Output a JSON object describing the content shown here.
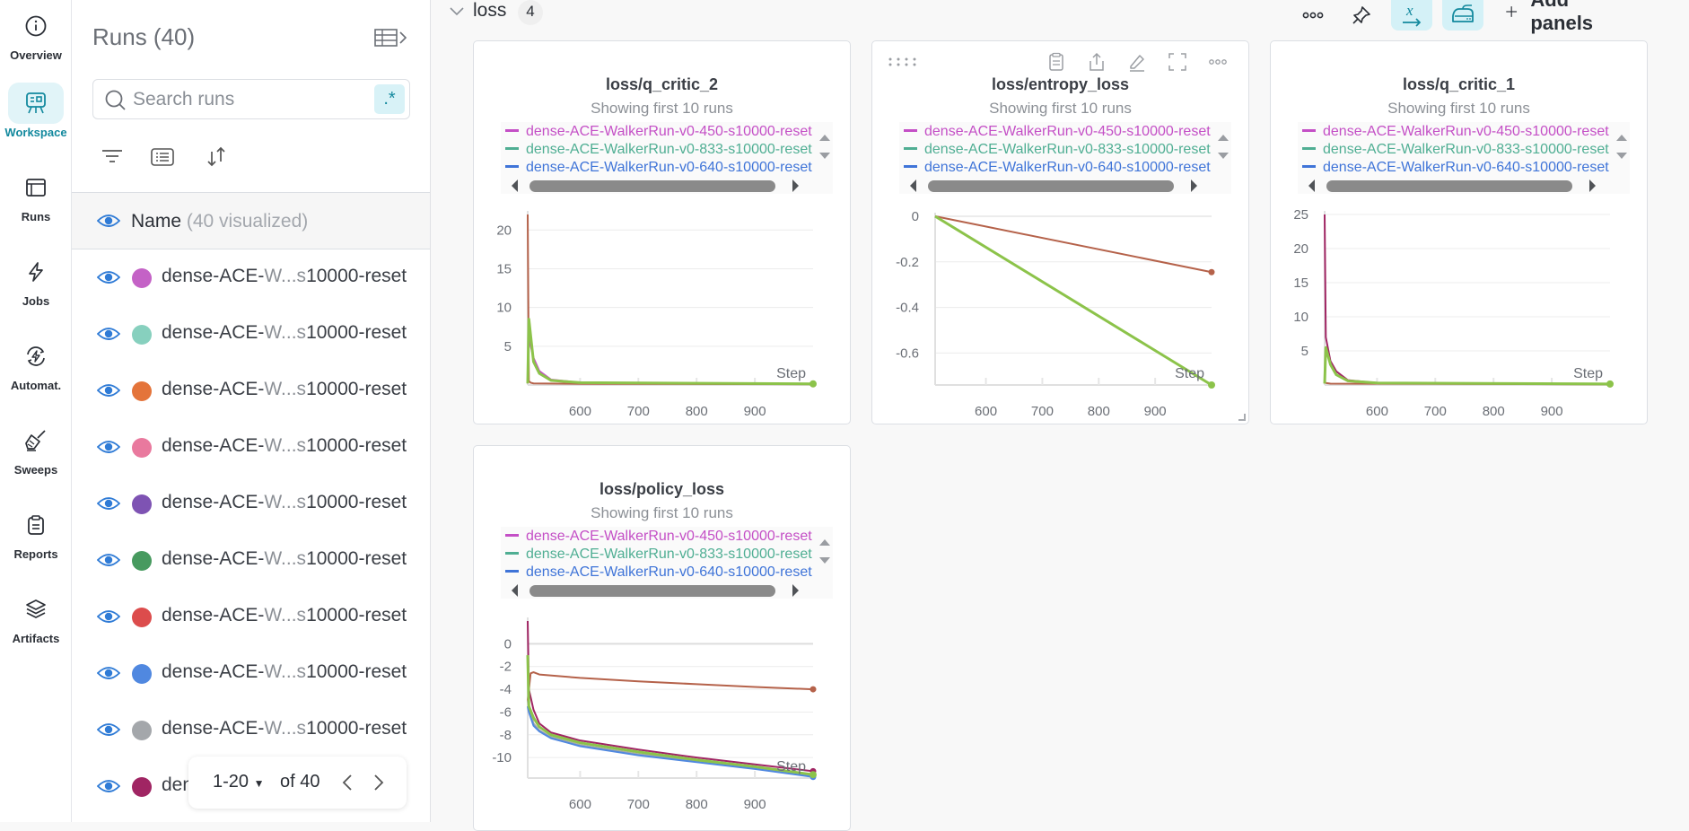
{
  "nav": {
    "items": [
      {
        "id": "overview",
        "label": "Overview",
        "icon": "info-icon",
        "active": false
      },
      {
        "id": "workspace",
        "label": "Workspace",
        "icon": "workspace-icon",
        "active": true
      },
      {
        "id": "runs",
        "label": "Runs",
        "icon": "table-icon",
        "active": false
      },
      {
        "id": "jobs",
        "label": "Jobs",
        "icon": "lightning-icon",
        "active": false
      },
      {
        "id": "automations",
        "label": "Automat.",
        "icon": "automation-icon",
        "active": false
      },
      {
        "id": "sweeps",
        "label": "Sweeps",
        "icon": "broom-icon",
        "active": false
      },
      {
        "id": "reports",
        "label": "Reports",
        "icon": "clipboard-icon",
        "active": false
      },
      {
        "id": "artifacts",
        "label": "Artifacts",
        "icon": "layers-icon",
        "active": false
      }
    ]
  },
  "runs_panel": {
    "title": "Runs (40)",
    "search_placeholder": "Search runs",
    "search_value": "",
    "regex_label": ".*",
    "name_header": "Name",
    "name_header_count": "(40 visualized)",
    "rows": [
      {
        "prefix": "dense-ACE-",
        "fade": "W...s",
        "suffix": "10000-reset",
        "color": "#c462c6",
        "visible": true
      },
      {
        "prefix": "dense-ACE-",
        "fade": "W...s",
        "suffix": "10000-reset",
        "color": "#87d0be",
        "visible": true
      },
      {
        "prefix": "dense-ACE-",
        "fade": "W...s",
        "suffix": "10000-reset",
        "color": "#e4743a",
        "visible": true
      },
      {
        "prefix": "dense-ACE-",
        "fade": "W...s",
        "suffix": "10000-reset",
        "color": "#e9799e",
        "visible": true
      },
      {
        "prefix": "dense-ACE-",
        "fade": "W...s",
        "suffix": "10000-reset",
        "color": "#7e53b3",
        "visible": true
      },
      {
        "prefix": "dense-ACE-",
        "fade": "W...s",
        "suffix": "10000-reset",
        "color": "#479a5f",
        "visible": true
      },
      {
        "prefix": "dense-ACE-",
        "fade": "W...s",
        "suffix": "10000-reset",
        "color": "#dc4c4c",
        "visible": true
      },
      {
        "prefix": "dense-ACE-",
        "fade": "W...s",
        "suffix": "10000-reset",
        "color": "#5088e0",
        "visible": true
      },
      {
        "prefix": "dense-ACE-",
        "fade": "W...s",
        "suffix": "10000-reset",
        "color": "#a4a7ab",
        "visible": true
      },
      {
        "prefix": "den",
        "fade": "",
        "suffix": "",
        "color": "#a02563",
        "visible": true
      }
    ],
    "pagination": {
      "range": "1-20",
      "of": "of 40"
    }
  },
  "section": {
    "title": "loss",
    "count": "4",
    "add_panels_label": "Add panels"
  },
  "legend_entries": [
    {
      "name": "dense-ACE-WalkerRun-v0-450-s10000-reset",
      "color": "#c44fc6"
    },
    {
      "name": "dense-ACE-WalkerRun-v0-833-s10000-reset",
      "color": "#4fae93"
    },
    {
      "name": "dense-ACE-WalkerRun-v0-640-s10000-reset",
      "color": "#3f74d8"
    }
  ],
  "chart_data": [
    {
      "type": "line",
      "title": "loss/q_critic_2",
      "subtitle": "Showing first 10 runs",
      "xlabel": "Step",
      "ylabel": "",
      "x_ticks": [
        600,
        700,
        800,
        900
      ],
      "y_ticks": [
        5,
        10,
        15,
        20
      ],
      "xlim": [
        510,
        1000
      ],
      "ylim": [
        0,
        22
      ],
      "grid": true,
      "series": [
        {
          "name": "brown-run",
          "color": "#b5624a",
          "x": [
            510,
            512,
            515,
            520,
            600,
            1000
          ],
          "y": [
            22,
            0.5,
            0.3,
            0.2,
            0.15,
            0.1
          ]
        },
        {
          "name": "magenta-run",
          "color": "#c44fc6",
          "x": [
            510,
            512,
            520,
            530,
            550,
            600,
            1000
          ],
          "y": [
            0.2,
            6,
            3.5,
            1.8,
            0.7,
            0.3,
            0.15
          ]
        },
        {
          "name": "green-run",
          "color": "#8cc34a",
          "x": [
            510,
            512,
            520,
            530,
            550,
            600,
            1000
          ],
          "y": [
            0.2,
            8.5,
            3.0,
            1.5,
            0.6,
            0.3,
            0.15
          ]
        }
      ]
    },
    {
      "type": "line",
      "title": "loss/entropy_loss",
      "subtitle": "Showing first 10 runs",
      "xlabel": "Step",
      "ylabel": "",
      "x_ticks": [
        600,
        700,
        800,
        900
      ],
      "y_ticks": [
        0,
        -0.2,
        -0.4,
        -0.6
      ],
      "xlim": [
        510,
        1000
      ],
      "ylim": [
        -0.74,
        0
      ],
      "grid": true,
      "series": [
        {
          "name": "brown-run",
          "color": "#b5624a",
          "x": [
            510,
            1000
          ],
          "y": [
            0,
            -0.245
          ]
        },
        {
          "name": "green-run",
          "color": "#8cc34a",
          "x": [
            510,
            1000
          ],
          "y": [
            0,
            -0.74
          ]
        }
      ]
    },
    {
      "type": "line",
      "title": "loss/q_critic_1",
      "subtitle": "Showing first 10 runs",
      "xlabel": "Step",
      "ylabel": "",
      "x_ticks": [
        600,
        700,
        800,
        900
      ],
      "y_ticks": [
        5,
        10,
        15,
        20,
        25
      ],
      "xlim": [
        510,
        1000
      ],
      "ylim": [
        0,
        25
      ],
      "grid": true,
      "series": [
        {
          "name": "brown-run",
          "color": "#b5624a",
          "x": [
            510,
            512,
            520,
            1000
          ],
          "y": [
            0.5,
            0.3,
            0.2,
            0.1
          ]
        },
        {
          "name": "crimson-run",
          "color": "#a02563",
          "x": [
            510,
            512,
            520,
            530,
            550,
            600,
            1000
          ],
          "y": [
            25,
            7,
            3.5,
            2,
            0.7,
            0.3,
            0.15
          ]
        },
        {
          "name": "green-run",
          "color": "#8cc34a",
          "x": [
            510,
            512,
            520,
            530,
            550,
            600,
            1000
          ],
          "y": [
            0.2,
            5.5,
            3,
            1.5,
            0.6,
            0.3,
            0.15
          ]
        }
      ]
    },
    {
      "type": "line",
      "title": "loss/policy_loss",
      "subtitle": "Showing first 10 runs",
      "xlabel": "Step",
      "ylabel": "",
      "x_ticks": [
        600,
        700,
        800,
        900
      ],
      "y_ticks": [
        0,
        -2,
        -4,
        -6,
        -8,
        -10
      ],
      "xlim": [
        510,
        1000
      ],
      "ylim": [
        -11.8,
        2
      ],
      "grid": true,
      "series": [
        {
          "name": "brown-run",
          "color": "#b5624a",
          "x": [
            510,
            515,
            520,
            530,
            600,
            700,
            800,
            900,
            1000
          ],
          "y": [
            -5,
            -2.6,
            -2.5,
            -2.7,
            -3.0,
            -3.3,
            -3.55,
            -3.8,
            -4.0
          ]
        },
        {
          "name": "crimson-run",
          "color": "#a02563",
          "x": [
            510,
            512,
            520,
            530,
            550,
            600,
            700,
            800,
            900,
            1000
          ],
          "y": [
            2,
            -4,
            -5.8,
            -7,
            -7.8,
            -8.5,
            -9.3,
            -10.0,
            -10.6,
            -11.2
          ]
        },
        {
          "name": "gray-run",
          "color": "#a4a7ab",
          "x": [
            510,
            512,
            520,
            530,
            550,
            600,
            700,
            800,
            900,
            1000
          ],
          "y": [
            -5,
            -5.5,
            -7.0,
            -7.6,
            -8.2,
            -8.9,
            -9.7,
            -10.3,
            -10.9,
            -11.6
          ]
        },
        {
          "name": "blue-run",
          "color": "#5088e0",
          "x": [
            510,
            512,
            520,
            530,
            550,
            600,
            700,
            800,
            900,
            1000
          ],
          "y": [
            -5.5,
            -6,
            -7.2,
            -7.7,
            -8.3,
            -9.0,
            -9.8,
            -10.4,
            -11.0,
            -11.7
          ]
        },
        {
          "name": "green-run",
          "color": "#8cc34a",
          "x": [
            510,
            512,
            520,
            530,
            550,
            600,
            700,
            800,
            900,
            1000
          ],
          "y": [
            -1,
            -5.5,
            -6.5,
            -7.3,
            -8.0,
            -8.7,
            -9.5,
            -10.2,
            -10.8,
            -11.5
          ]
        }
      ]
    }
  ]
}
